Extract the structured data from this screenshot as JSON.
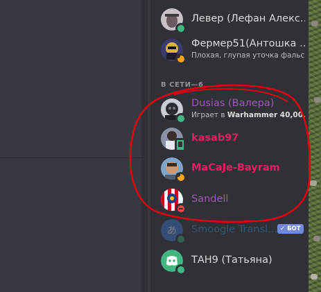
{
  "members_top": [
    {
      "name": "Левер (Лефан Алекс…",
      "status": "online",
      "name_color": "#dcddde"
    },
    {
      "name": "Фермер51(Антошка …",
      "status": "idle",
      "name_color": "#dcddde",
      "activity": "Плохая, глупая уточка фальс…"
    }
  ],
  "online_section": {
    "header": "В СЕТИ—6",
    "members": [
      {
        "name": "Dusias (Валера)",
        "status": "online",
        "name_color": "#9b59b6",
        "activity_prefix": "Играет в ",
        "activity_game": "Warhammer 40,00…"
      },
      {
        "name": "kasab97",
        "status": "mobile",
        "name_color": "#e91e63"
      },
      {
        "name": "MaCaJe-Bayram",
        "status": "idle",
        "name_color": "#e91e63"
      },
      {
        "name": "Sandell",
        "status": "dnd",
        "name_color": "#9b59b6"
      },
      {
        "name": "Smoogle Transl…",
        "status": "online",
        "name_color": "#3498db",
        "bot_tag": "✓ БОТ"
      },
      {
        "name": "ТАН9 (Татьяна)",
        "status": "online",
        "name_color": "#dcddde"
      }
    ]
  },
  "colors": {
    "members_bg": "#2f3136",
    "chat_bg": "#36393f",
    "annotation": "#e3000f"
  }
}
